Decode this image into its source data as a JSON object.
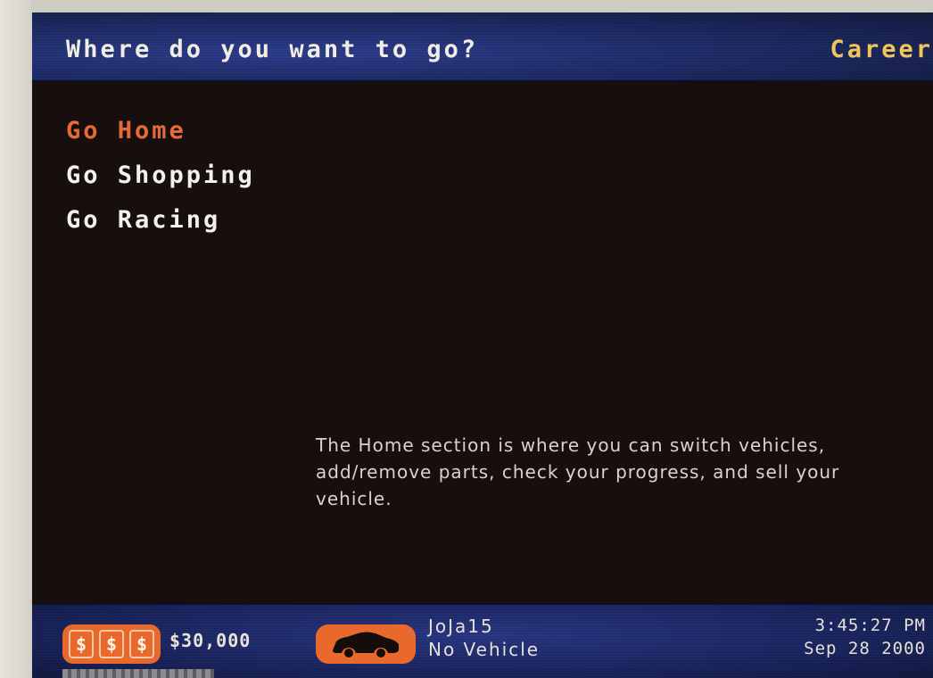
{
  "header": {
    "prompt": "Where do you want to go?",
    "mode": "Career"
  },
  "menu": {
    "items": [
      {
        "label": "Go Home",
        "selected": true
      },
      {
        "label": "Go Shopping",
        "selected": false
      },
      {
        "label": "Go Racing",
        "selected": false
      }
    ]
  },
  "description": "The Home section is where you can switch vehicles, add/remove parts, check your progress, and sell your vehicle.",
  "footer": {
    "money_icon_glyphs": [
      "$",
      "$",
      "$"
    ],
    "money": "$30,000",
    "driver": "JoJa15",
    "vehicle": "No Vehicle",
    "time": "3:45:27 PM",
    "date": "Sep 28 2000"
  },
  "colors": {
    "selected_item": "#e56a3a",
    "menu_item": "#f4f1ea",
    "mode_label": "#f2c55a",
    "badge": "#e8692b",
    "header_bg": "#1d2a63",
    "screen_bg": "#170f0d"
  },
  "icons": {
    "money": "money-icon",
    "vehicle": "car-icon"
  }
}
